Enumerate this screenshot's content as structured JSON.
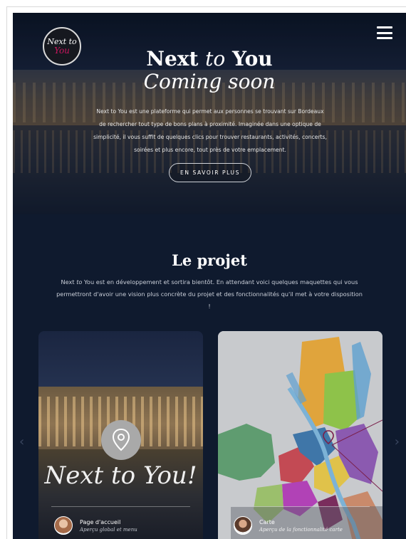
{
  "header": {
    "logo_line1": "Next to",
    "logo_line2": "You",
    "title_main": "Next ",
    "title_to": "to",
    "title_end": " You",
    "subtitle": "Coming soon",
    "description": "Next to You est une plateforme qui permet aux personnes se trouvant sur Bordeaux de rechercher tout type de bons plans à proximité. Imaginée dans une optique de simplicité, il vous suffit de quelques clics pour trouver restaurants, activités, concerts, soirées et plus encore, tout près de votre emplacement.",
    "cta_label": "EN SAVOIR PLUS",
    "menu_icon": "hamburger-menu-icon"
  },
  "project": {
    "title": "Le projet",
    "desc_prefix": "Next ",
    "desc_to": "to",
    "desc_rest": " You est en développement et sortira bientôt. En attendant voici quelques maquettes qui vous permettront d'avoir une vision plus concrète du projet et des fonctionnalités qu'il met à votre disposition !",
    "arrow_left": "‹",
    "arrow_right": "›"
  },
  "cards": [
    {
      "brand": "Next to You!",
      "title": "Page d'accueil",
      "subtitle": "Aperçu global et menu"
    },
    {
      "title": "Carte",
      "subtitle": "Aperçu de la fonctionnalité carte"
    }
  ],
  "colors": {
    "accent": "#c8165d",
    "background": "#0f1a2e"
  }
}
